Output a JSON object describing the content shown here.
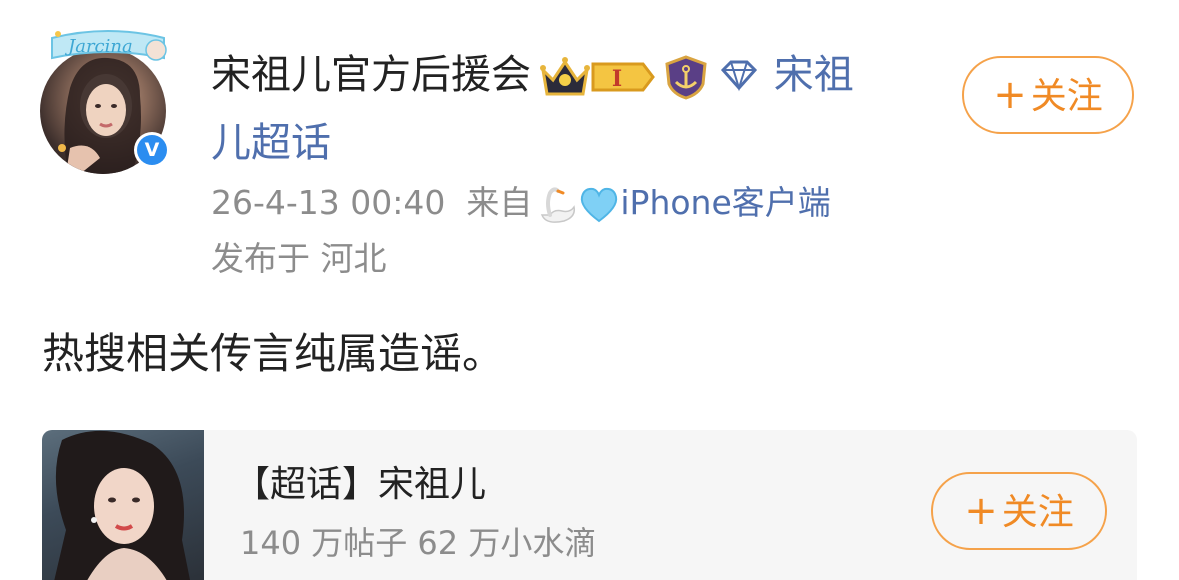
{
  "post": {
    "author": {
      "name": "宋祖儿官方后援会",
      "avatar_banner_text": "Jarcina",
      "verified": true
    },
    "topic_part1": "宋祖",
    "topic_part2": "儿超话",
    "follow_label": "关注",
    "follow_plus": "+",
    "badge_level": "I",
    "timestamp": "26-4-13 00:40",
    "source_prefix": "来自",
    "source_client": "iPhone客户端",
    "location": "发布于 河北",
    "text": "热搜相关传言纯属造谣。"
  },
  "card": {
    "title": "【超话】宋祖儿",
    "stats": "140 万帖子 62 万小水滴",
    "follow_label": "关注",
    "follow_plus": "+"
  },
  "colors": {
    "accent_orange": "#f08a25",
    "link_blue": "#4f6fad",
    "verified_blue": "#2b8df0",
    "meta_gray": "#8c8c8c"
  },
  "icons": {
    "crown": "crown-icon",
    "level_badge": "level-badge-icon",
    "shield": "anchor-shield-icon",
    "diamond": "diamond-icon",
    "swan": "swan-icon",
    "heart": "blue-heart-icon",
    "verified": "verified-v-icon"
  }
}
